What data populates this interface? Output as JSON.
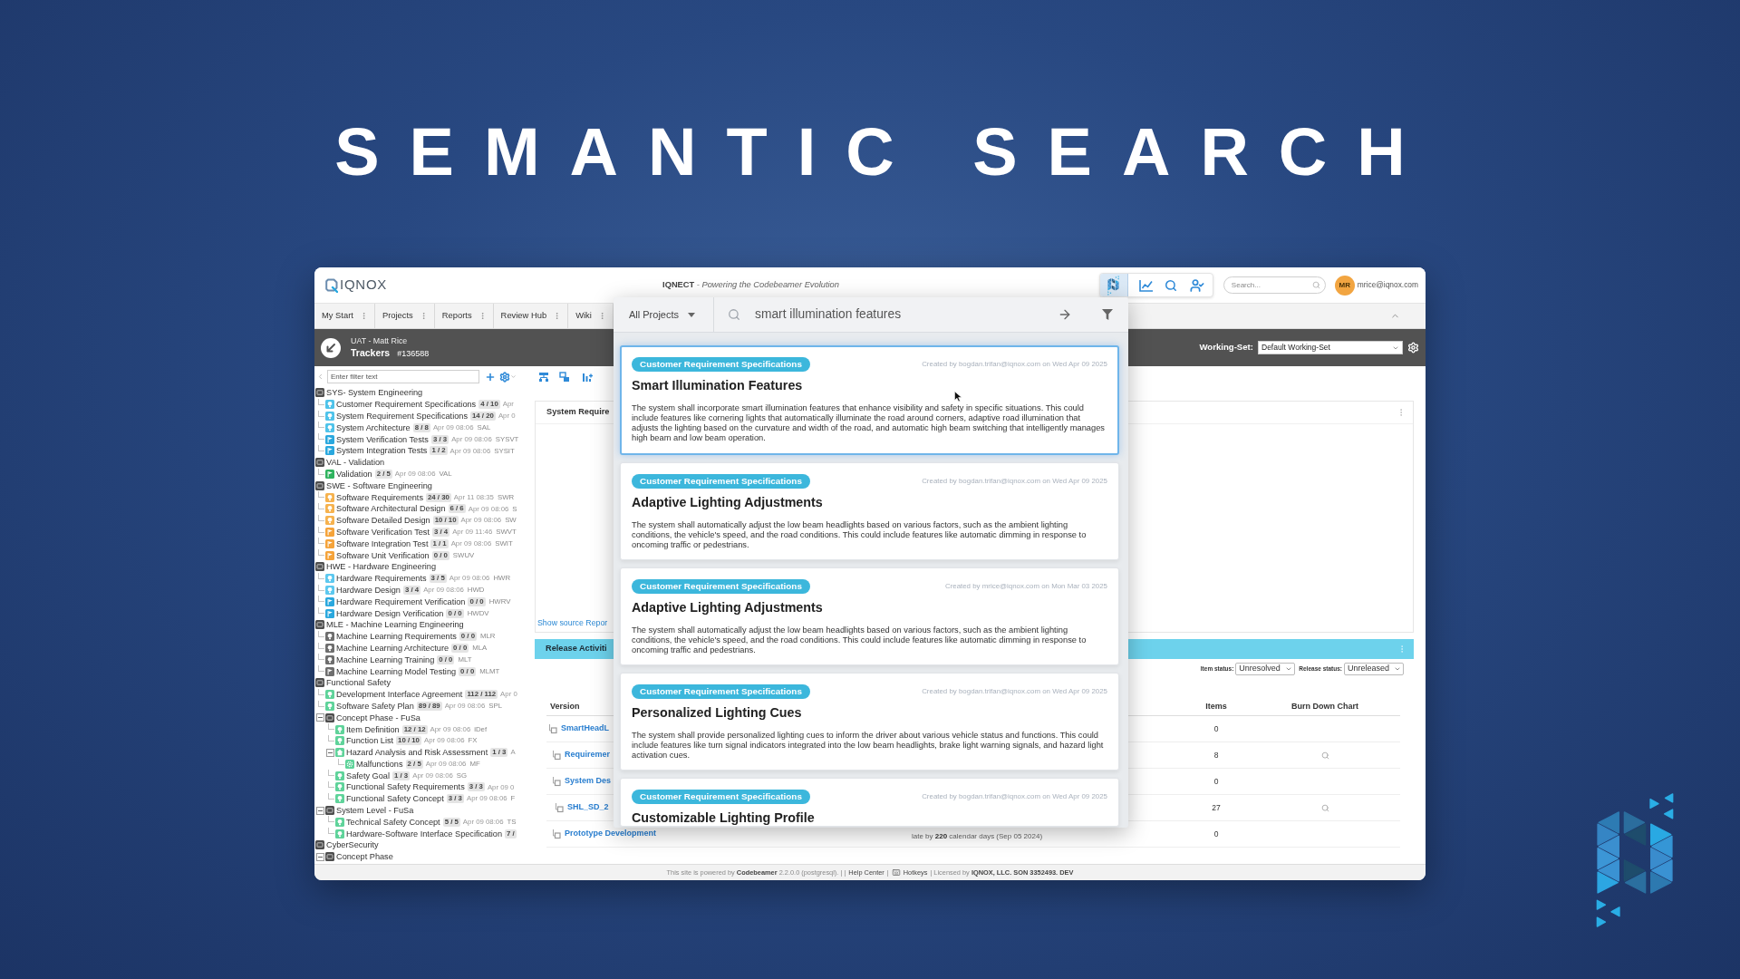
{
  "title": "SEMANTIC SEARCH",
  "header": {
    "logo_text": "IQNOX",
    "tagline": "**IQNECT** *- Powering the Codebeamer Evolution*",
    "search_placeholder": "Search...",
    "avatar_initials": "MR",
    "user_email": "mrice@iqnox.com"
  },
  "nav_tabs": [
    {
      "label": "My Start"
    },
    {
      "label": "Projects"
    },
    {
      "label": "Reports"
    },
    {
      "label": "Review Hub"
    },
    {
      "label": "Wiki"
    }
  ],
  "context_bar": {
    "subtitle": "UAT - Matt Rice",
    "title": "Trackers",
    "id": "#136588",
    "working_set_label": "Working-Set:",
    "working_set_value": "Default Working-Set"
  },
  "sidebar": {
    "filter_placeholder": "Enter filter text",
    "tree": [
      {
        "kind": "group",
        "label": "SYS- System Engineering",
        "children": [
          {
            "kind": "requirement",
            "color": "#4fc3ea",
            "label": "Customer Requirement Specifications",
            "count": "4 / 10",
            "date": "Apr"
          },
          {
            "kind": "requirement",
            "color": "#4fc3ea",
            "label": "System Requirement Specifications",
            "count": "14 / 20",
            "date": "Apr 0"
          },
          {
            "kind": "requirement",
            "color": "#4fc3ea",
            "label": "System Architecture",
            "count": "8 / 8",
            "date": "Apr 09 08:06",
            "code": "SAL"
          },
          {
            "kind": "test",
            "color": "#2aa8de",
            "label": "System Verification Tests",
            "count": "3 / 3",
            "date": "Apr 09 08:06",
            "code": "SYSVT"
          },
          {
            "kind": "test",
            "color": "#2aa8de",
            "label": "System Integration Tests",
            "count": "1 / 2",
            "date": "Apr 09 08:06",
            "code": "SYSIT"
          }
        ]
      },
      {
        "kind": "group",
        "label": "VAL - Validation",
        "children": [
          {
            "kind": "test",
            "color": "#2fb35e",
            "label": "Validation",
            "count": "2 / 5",
            "date": "Apr 09 08:06",
            "code": "VAL"
          }
        ]
      },
      {
        "kind": "group",
        "label": "SWE - Software Engineering",
        "children": [
          {
            "kind": "requirement",
            "color": "#f6b24e",
            "label": "Software Requirements",
            "count": "24 / 30",
            "date": "Apr 11 08:35",
            "code": "SWR"
          },
          {
            "kind": "requirement",
            "color": "#f6b24e",
            "label": "Software Architectural Design",
            "count": "6 / 6",
            "date": "Apr 09 08:06",
            "code": "S"
          },
          {
            "kind": "requirement",
            "color": "#f6b24e",
            "label": "Software Detailed Design",
            "count": "10 / 10",
            "date": "Apr 09 08:06",
            "code": "SW"
          },
          {
            "kind": "test",
            "color": "#f5a33a",
            "label": "Software Verification Test",
            "count": "3 / 4",
            "date": "Apr 09 11:46",
            "code": "SWVT"
          },
          {
            "kind": "test",
            "color": "#f5a33a",
            "label": "Software Integration Test",
            "count": "1 / 1",
            "date": "Apr 09 08:06",
            "code": "SWIT"
          },
          {
            "kind": "test",
            "color": "#f5a33a",
            "label": "Software Unit Verification",
            "count": "0 / 0",
            "code": "SWUV"
          }
        ]
      },
      {
        "kind": "group",
        "label": "HWE - Hardware Engineering",
        "children": [
          {
            "kind": "requirement",
            "color": "#5cc8ef",
            "label": "Hardware Requirements",
            "count": "3 / 5",
            "date": "Apr 09 08:06",
            "code": "HWR"
          },
          {
            "kind": "requirement",
            "color": "#5cc8ef",
            "label": "Hardware Design",
            "count": "3 / 4",
            "date": "Apr 09 08:06",
            "code": "HWD"
          },
          {
            "kind": "test",
            "color": "#2aa8de",
            "label": "Hardware Requirement Verification",
            "count": "0 / 0",
            "code": "HWRV"
          },
          {
            "kind": "test",
            "color": "#2aa8de",
            "label": "Hardware Design Verification",
            "count": "0 / 0",
            "code": "HWDV"
          }
        ]
      },
      {
        "kind": "group",
        "label": "MLE - Machine Learning Engineering",
        "children": [
          {
            "kind": "requirement",
            "color": "#6e6e6e",
            "label": "Machine Learning Requirements",
            "count": "0 / 0",
            "code": "MLR"
          },
          {
            "kind": "requirement",
            "color": "#6e6e6e",
            "label": "Machine Learning Architecture",
            "count": "0 / 0",
            "code": "MLA"
          },
          {
            "kind": "requirement",
            "color": "#6e6e6e",
            "label": "Machine Learning Training",
            "count": "0 / 0",
            "code": "MLT"
          },
          {
            "kind": "test",
            "color": "#6e6e6e",
            "label": "Machine Learning Model Testing",
            "count": "0 / 0",
            "code": "MLMT"
          }
        ]
      },
      {
        "kind": "group",
        "label": "Functional Safety",
        "children": [
          {
            "kind": "requirement",
            "color": "#5fd39a",
            "label": "Development Interface Agreement",
            "count": "112 / 112",
            "date": "Apr 0"
          },
          {
            "kind": "requirement",
            "color": "#5fd39a",
            "label": "Software Safety Plan",
            "count": "89 / 89",
            "date": "Apr 09 08:06",
            "code": "SPL"
          },
          {
            "kind": "group",
            "label": "Concept Phase - FuSa",
            "expanded": true,
            "children": [
              {
                "kind": "requirement",
                "color": "#5fd39a",
                "label": "Item Definition",
                "count": "12 / 12",
                "date": "Apr 09 08:06",
                "code": "iDef"
              },
              {
                "kind": "requirement",
                "color": "#5fd39a",
                "label": "Function List",
                "count": "10 / 10",
                "date": "Apr 09 08:06",
                "code": "FX"
              },
              {
                "kind": "risk",
                "color": "#5fd39a",
                "label": "Hazard Analysis and Risk Assessment",
                "count": "1 / 3",
                "date": "A",
                "expanded": true,
                "children": [
                  {
                    "kind": "config",
                    "color": "#5fd39a",
                    "label": "Malfunctions",
                    "count": "2 / 5",
                    "date": "Apr 09 08:06",
                    "code": "MF"
                  }
                ]
              },
              {
                "kind": "requirement",
                "color": "#5fd39a",
                "label": "Safety Goal",
                "count": "1 / 3",
                "date": "Apr 09 08:06",
                "code": "SG"
              },
              {
                "kind": "requirement",
                "color": "#5fd39a",
                "label": "Functional Safety Requirements",
                "count": "3 / 3",
                "date": "Apr 09 0"
              },
              {
                "kind": "requirement",
                "color": "#5fd39a",
                "label": "Functional Safety Concept",
                "count": "3 / 3",
                "date": "Apr 09 08:06",
                "code": "F"
              }
            ]
          },
          {
            "kind": "group",
            "label": "System Level - FuSa",
            "expanded": true,
            "children": [
              {
                "kind": "requirement",
                "color": "#5fd39a",
                "label": "Technical Safety Concept",
                "count": "5 / 5",
                "date": "Apr 09 08:06",
                "code": "TS"
              },
              {
                "kind": "requirement",
                "color": "#5fd39a",
                "label": "Hardware-Software Interface Specification",
                "count": "7 /"
              }
            ]
          }
        ]
      },
      {
        "kind": "group",
        "label": "CyberSecurity",
        "children": [
          {
            "kind": "group",
            "label": "Concept Phase",
            "expanded": true
          }
        ]
      }
    ]
  },
  "content": {
    "panel_title": "System Require",
    "source_link": "Show source Repor",
    "release_title": "Release Activiti",
    "item_status": {
      "label": "Item status:",
      "value": "Unresolved"
    },
    "release_status": {
      "label": "Release status:",
      "value": "Unreleased"
    },
    "columns": [
      {
        "label": "Version"
      },
      {
        "label": "Items"
      },
      {
        "label": "Burn Down Chart"
      }
    ],
    "versions": [
      {
        "name": "SmartHeadL",
        "items": "0",
        "chart_link": false,
        "children": [
          {
            "name": "Requiremer",
            "items": "8",
            "chart_link": true
          },
          {
            "name": "System Des",
            "items": "0",
            "chart_link": false,
            "children": [
              {
                "name": "SHL_SD_2",
                "items": "27",
                "chart_link": true
              }
            ]
          },
          {
            "name": "Prototype Development",
            "status": "late by **220** calendar days (Sep 05 2024)",
            "items": "0",
            "chart_link": false
          }
        ]
      }
    ]
  },
  "search_overlay": {
    "scope": "All Projects",
    "query": "smart illumination features",
    "results": [
      {
        "tracker": "Customer Requirement Specifications",
        "created": "Created by bogdan.trifan@iqnox.com on Wed Apr 09 2025",
        "title": "Smart Illumination Features",
        "description": "The system shall incorporate smart illumination features that enhance visibility and safety in specific situations. This could include features like cornering lights that automatically illuminate the road around corners, adaptive road illumination that adjusts the lighting based on the curvature and width of the road, and automatic high beam switching that intelligently manages high beam and low beam operation.",
        "selected": true
      },
      {
        "tracker": "Customer Requirement Specifications",
        "created": "Created by bogdan.trifan@iqnox.com on Wed Apr 09 2025",
        "title": "Adaptive Lighting Adjustments",
        "description": "The system shall automatically adjust the low beam headlights based on various factors, such as the ambient lighting conditions, the vehicle's speed, and the road conditions. This could include features like automatic dimming in response to oncoming traffic or pedestrians.",
        "selected": false
      },
      {
        "tracker": "Customer Requirement Specifications",
        "created": "Created by mrice@iqnox.com on Mon Mar 03 2025",
        "title": "Adaptive Lighting Adjustments",
        "description": "The system shall automatically adjust the low beam headlights based on various factors, such as the ambient lighting conditions, the vehicle's speed, and the road conditions. This could include features like automatic dimming in response to oncoming traffic and pedestrians.",
        "selected": false
      },
      {
        "tracker": "Customer Requirement Specifications",
        "created": "Created by bogdan.trifan@iqnox.com on Wed Apr 09 2025",
        "title": "Personalized Lighting Cues",
        "description": "The system shall provide personalized lighting cues to inform the driver about various vehicle status and functions. This could include features like turn signal indicators integrated into the low beam headlights, brake light warning signals, and hazard light activation cues.",
        "selected": false
      },
      {
        "tracker": "Customer Requirement Specifications",
        "created": "Created by bogdan.trifan@iqnox.com on Wed Apr 09 2025",
        "title": "Customizable Lighting Profile",
        "selected": false
      }
    ]
  },
  "footer": {
    "powered_by": "This site is powered by **Codebeamer** 2.2.0.0 (postgresql). | |",
    "help_link": "Help Center",
    "divider": "|",
    "hotkeys_link": "Hotkeys",
    "license": "| Licensed by **IQNOX, LLC. SON 3352493. DEV**"
  }
}
